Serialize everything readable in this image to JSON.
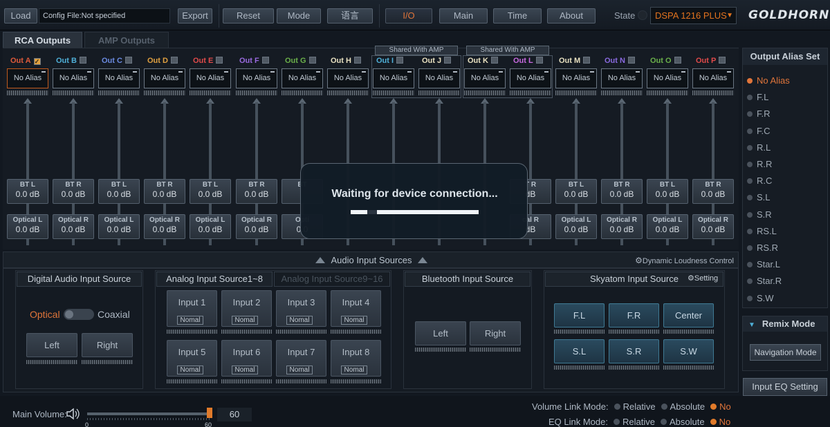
{
  "topbar": {
    "load": "Load",
    "config_file": "Config File:Not specified",
    "export": "Export",
    "reset": "Reset",
    "mode": "Mode",
    "language": "语言",
    "tabs": [
      "I/O",
      "Main",
      "Time",
      "About"
    ],
    "active_tab": "I/O",
    "state_label": "State",
    "device": "DSPA 1216 PLUS",
    "logo": "GOLDHORN"
  },
  "output_tabs": {
    "rca": "RCA Outputs",
    "amp": "AMP Outputs"
  },
  "outputs": [
    {
      "label": "Out A",
      "color": "#e05a3a",
      "checked": true,
      "alias": "No Alias"
    },
    {
      "label": "Out B",
      "color": "#4fb0d8",
      "checked": false,
      "alias": "No Alias"
    },
    {
      "label": "Out C",
      "color": "#6a8ae0",
      "checked": false,
      "alias": "No Alias"
    },
    {
      "label": "Out D",
      "color": "#e0a040",
      "checked": false,
      "alias": "No Alias"
    },
    {
      "label": "Out E",
      "color": "#e04a4a",
      "checked": false,
      "alias": "No Alias"
    },
    {
      "label": "Out F",
      "color": "#9a6ae0",
      "checked": false,
      "alias": "No Alias"
    },
    {
      "label": "Out G",
      "color": "#6ab04a",
      "checked": false,
      "alias": "No Alias"
    },
    {
      "label": "Out H",
      "color": "#e8e0c0",
      "checked": false,
      "alias": "No Alias"
    },
    {
      "label": "Out I",
      "color": "#4fb0d8",
      "checked": false,
      "alias": "No Alias"
    },
    {
      "label": "Out J",
      "color": "#e8e0c0",
      "checked": false,
      "alias": "No Alias"
    },
    {
      "label": "Out K",
      "color": "#e8e0c0",
      "checked": false,
      "alias": "No Alias"
    },
    {
      "label": "Out L",
      "color": "#c86ae0",
      "checked": false,
      "alias": "No Alias"
    },
    {
      "label": "Out M",
      "color": "#e8e0c0",
      "checked": false,
      "alias": "No Alias"
    },
    {
      "label": "Out N",
      "color": "#8a6ae0",
      "checked": false,
      "alias": "No Alias"
    },
    {
      "label": "Out O",
      "color": "#6ab04a",
      "checked": false,
      "alias": "No Alias"
    },
    {
      "label": "Out P",
      "color": "#e04a4a",
      "checked": false,
      "alias": "No Alias"
    }
  ],
  "shared_label": "Shared With AMP",
  "sources_bt": [
    {
      "t": "BT L",
      "v": "0.0 dB"
    },
    {
      "t": "BT R",
      "v": "0.0 dB"
    },
    {
      "t": "BT L",
      "v": "0.0 dB"
    },
    {
      "t": "BT R",
      "v": "0.0 dB"
    },
    {
      "t": "BT L",
      "v": "0.0 dB"
    },
    {
      "t": "BT R",
      "v": "0.0 dB"
    },
    {
      "t": "BT",
      "v": ""
    },
    {
      "t": "",
      "v": ""
    },
    {
      "t": "",
      "v": ""
    },
    {
      "t": "",
      "v": ""
    },
    {
      "t": "",
      "v": ""
    },
    {
      "t": "T R",
      "v": "dB"
    },
    {
      "t": "BT L",
      "v": "0.0 dB"
    },
    {
      "t": "BT R",
      "v": "0.0 dB"
    },
    {
      "t": "BT L",
      "v": "0.0 dB"
    },
    {
      "t": "BT R",
      "v": "0.0 dB"
    }
  ],
  "sources_opt": [
    {
      "t": "Optical L",
      "v": "0.0 dB"
    },
    {
      "t": "Optical R",
      "v": "0.0 dB"
    },
    {
      "t": "Optical L",
      "v": "0.0 dB"
    },
    {
      "t": "Optical R",
      "v": "0.0 dB"
    },
    {
      "t": "Optical L",
      "v": "0.0 dB"
    },
    {
      "t": "Optical R",
      "v": "0.0 dB"
    },
    {
      "t": "Opti",
      "v": "0.0"
    },
    {
      "t": "",
      "v": ""
    },
    {
      "t": "",
      "v": ""
    },
    {
      "t": "",
      "v": ""
    },
    {
      "t": "",
      "v": ""
    },
    {
      "t": "cal R",
      "v": "dB"
    },
    {
      "t": "Optical L",
      "v": "0.0 dB"
    },
    {
      "t": "Optical R",
      "v": "0.0 dB"
    },
    {
      "t": "Optical L",
      "v": "0.0 dB"
    },
    {
      "t": "Optical R",
      "v": "0.0 dB"
    }
  ],
  "modal": {
    "title": "Waiting for device connection..."
  },
  "audio_input": {
    "title": "Audio Input Sources",
    "dynamic_loudness": "Dynamic Loudness Control",
    "digital": {
      "title": "Digital Audio Input Source",
      "optical": "Optical",
      "coaxial": "Coaxial",
      "left": "Left",
      "right": "Right"
    },
    "analog": {
      "tab1": "Analog Input Source1~8",
      "tab2": "Analog Input Source9~16",
      "inputs": [
        "Input 1",
        "Input 2",
        "Input 3",
        "Input 4",
        "Input 5",
        "Input 6",
        "Input 7",
        "Input 8"
      ],
      "mode": "Nomal"
    },
    "bluetooth": {
      "title": "Bluetooth Input Source",
      "left": "Left",
      "right": "Right"
    },
    "skyatom": {
      "title": "Skyatom Input Source",
      "setting": "Setting",
      "buttons": [
        "F.L",
        "F.R",
        "Center",
        "S.L",
        "S.R",
        "S.W"
      ]
    }
  },
  "alias_panel": {
    "title": "Output Alias Set",
    "items": [
      "No Alias",
      "F.L",
      "F.R",
      "F.C",
      "R.L",
      "R.R",
      "R.C",
      "S.L",
      "S.R",
      "RS.L",
      "RS.R",
      "Star.L",
      "Star.R",
      "S.W"
    ],
    "selected": "No Alias"
  },
  "remix": {
    "title": "Remix Mode",
    "nav": "Navigation Mode"
  },
  "input_eq": "Input EQ Setting",
  "bottom": {
    "main_volume": "Main Volume:",
    "volume": 60,
    "vol_min": "0",
    "vol_max": "60",
    "volume_display": "60",
    "volume_link": {
      "label": "Volume Link Mode:",
      "options": [
        "Relative",
        "Absolute",
        "No"
      ],
      "selected": "No"
    },
    "eq_link": {
      "label": "EQ Link Mode:",
      "options": [
        "Relative",
        "Absolute",
        "No"
      ],
      "selected": "No"
    }
  }
}
